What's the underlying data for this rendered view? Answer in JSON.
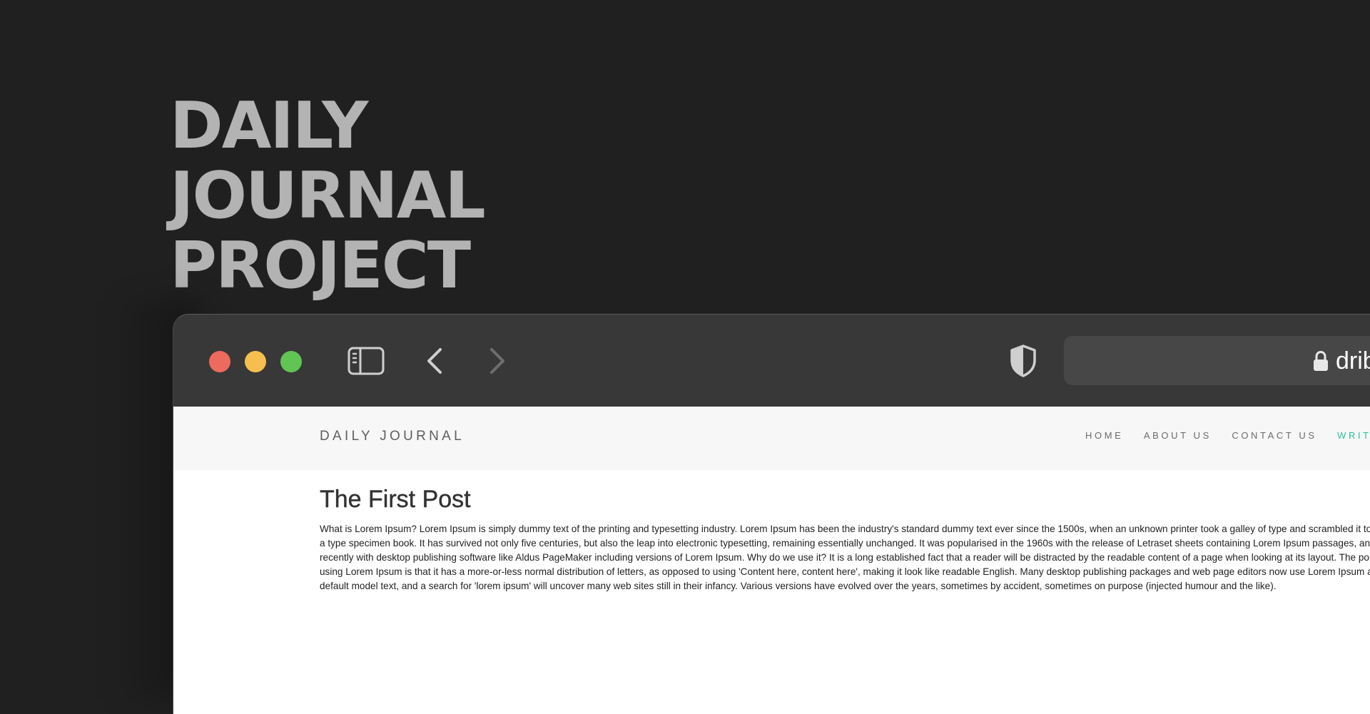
{
  "hero": {
    "line1": "DAILY",
    "line2": "JOURNAL",
    "line3": "PROJECT"
  },
  "browser": {
    "icons": {
      "close": "red-circle",
      "minimize": "yellow-circle",
      "maximize": "green-circle",
      "sidebar": "sidebar-icon",
      "back": "chevron-left-icon",
      "forward": "chevron-right-icon",
      "privacy": "shield-icon",
      "secure": "lock-icon"
    },
    "address": "dribbble.com"
  },
  "site": {
    "logo": "DAILY JOURNAL",
    "nav": {
      "home": "HOME",
      "about": "ABOUT US",
      "contact": "CONTACT US",
      "write": "WRITE"
    },
    "accent_color": "#2bbf9e"
  },
  "post": {
    "title": "The First Post",
    "body": "What is Lorem Ipsum? Lorem Ipsum is simply dummy text of the printing and typesetting industry. Lorem Ipsum has been the industry's standard dummy text ever since the 1500s, when an unknown printer took a galley of type and scrambled it to make a type specimen book. It has survived not only five centuries, but also the leap into electronic typesetting, remaining essentially unchanged. It was popularised in the 1960s with the release of Letraset sheets containing Lorem Ipsum passages, and more recently with desktop publishing software like Aldus PageMaker including versions of Lorem Ipsum. Why do we use it? It is a long established fact that a reader will be distracted by the readable content of a page when looking at its layout. The point of using Lorem Ipsum is that it has a more-or-less normal distribution of letters, as opposed to using 'Content here, content here', making it look like readable English. Many desktop publishing packages and web page editors now use Lorem Ipsum as their default model text, and a search for 'lorem ipsum' will uncover many web sites still in their infancy. Various versions have evolved over the years, sometimes by accident, sometimes on purpose (injected humour and the like)."
  }
}
